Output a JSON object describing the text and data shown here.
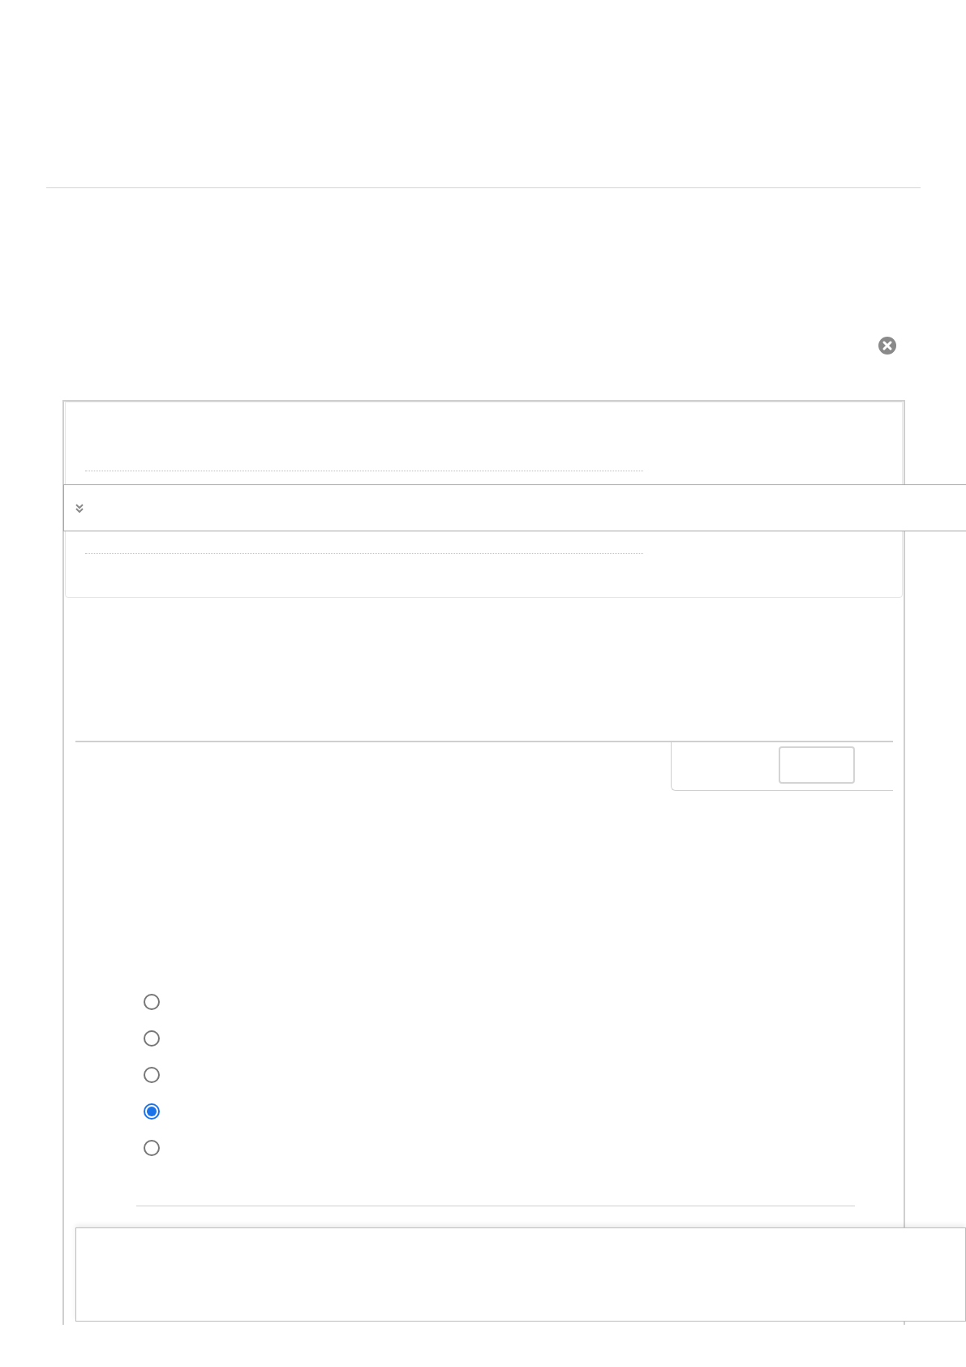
{
  "options": [
    {
      "selected": false
    },
    {
      "selected": false
    },
    {
      "selected": false
    },
    {
      "selected": true
    },
    {
      "selected": false
    }
  ]
}
